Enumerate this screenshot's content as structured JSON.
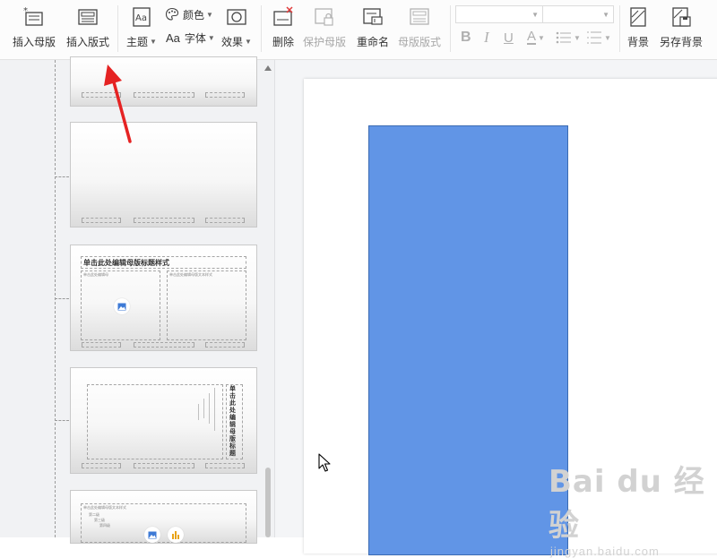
{
  "ribbon": {
    "insert_master": "插入母版",
    "insert_layout": "插入版式",
    "theme": "主题",
    "colors": "颜色",
    "fonts": "字体",
    "fonts_prefix": "Aa",
    "effects": "效果",
    "delete": "删除",
    "protect_master": "保护母版",
    "rename": "重命名",
    "master_layout": "母版版式",
    "background": "背景",
    "save_background": "另存背景",
    "font_name_value": "",
    "font_size_value": "",
    "bold": "B",
    "italic": "I",
    "underline": "U",
    "font_color": "A"
  },
  "thumbnails": {
    "thumb3_title": "单击此处编辑母版标题样式",
    "thumb3_left_text": "单击此处编辑母",
    "thumb3_right_text": "单击此处编辑母版文本样式",
    "thumb4_vertical_title": "单击此处编辑母版标题",
    "thumb5_text": "单击此处编辑母版文本样式",
    "thumb5_level2": "第二级",
    "thumb5_level3": "第三级",
    "thumb5_level4": "第四级"
  },
  "watermark": {
    "logo": "Bai du 经验",
    "url": "jingyan.baidu.com"
  },
  "colors": {
    "accent_blue": "#6195e6",
    "arrow_red": "#e52323"
  }
}
